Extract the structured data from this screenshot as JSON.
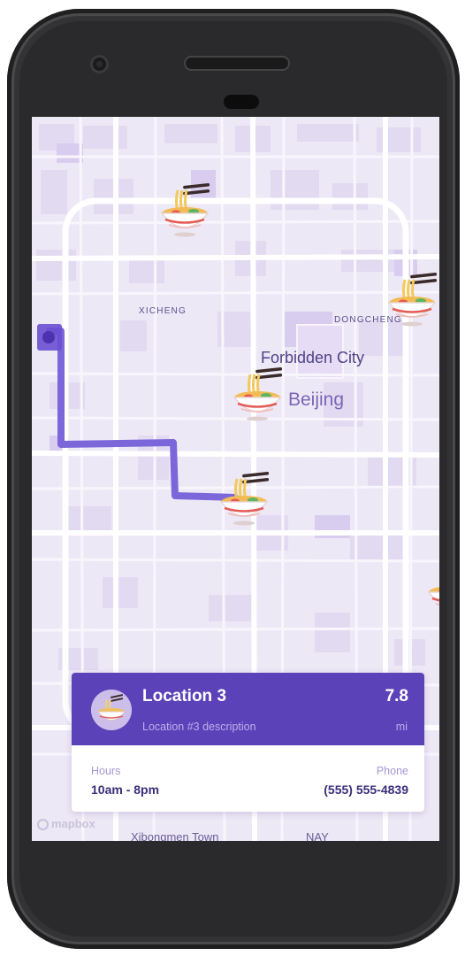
{
  "map": {
    "labels": {
      "xicheng": "XICHENG",
      "dongcheng": "DONGCHENG",
      "forbidden_city": "Forbidden City",
      "beijing": "Beijing",
      "bottom_left": "Xibongmen Town",
      "bottom_right": "NAY"
    },
    "attribution": "mapbox",
    "marker_icon": "ramen-bowl-icon",
    "colors": {
      "route": "#7b67d9",
      "user_location": "#6a4fd0",
      "map_background": "#ede8f6"
    }
  },
  "card": {
    "title": "Location 3",
    "description": "Location #3 description",
    "distance": "7.8",
    "distance_unit": "mi",
    "hours_label": "Hours",
    "hours_value": "10am - 8pm",
    "phone_label": "Phone",
    "phone_value": "(555) 555-4839",
    "header_color": "#5c42b8"
  }
}
